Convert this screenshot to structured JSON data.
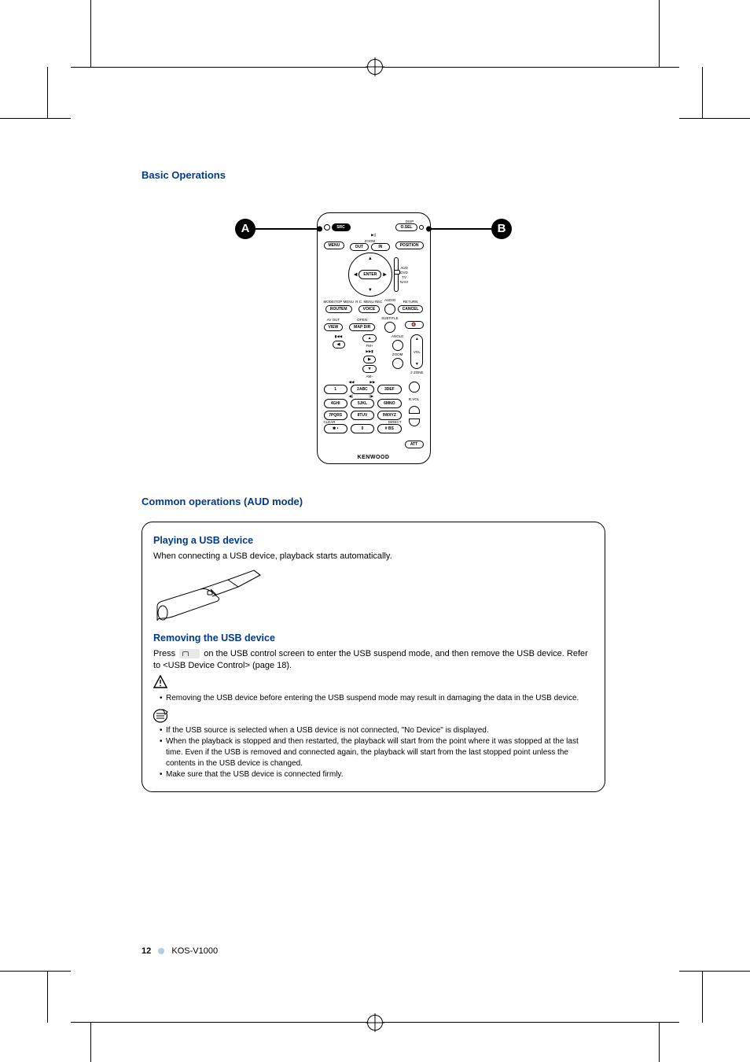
{
  "header": {
    "section_title": "Basic Operations"
  },
  "callouts": {
    "a": "A",
    "b": "B"
  },
  "remote": {
    "top_labels": {
      "disp": "DISP"
    },
    "src": "SRC",
    "osel": "O.SEL",
    "zoom_row": {
      "menu": "MENU",
      "zoom": "ZOOM",
      "out": "OUT",
      "in": "IN",
      "position": "POSITION"
    },
    "enter": "ENTER",
    "mode_labels": {
      "aud": "AUD",
      "dvd": "DVD",
      "tv": "TV",
      "navi": "NAVI"
    },
    "row_fn": {
      "routem_top": "MODE/TOP MENU",
      "routem": "ROUTEM",
      "voice_top": "R.C. MENU REC",
      "voice": "VOICE",
      "audio_top": "AUDIO",
      "cancel_top": "RETURN",
      "cancel": "CANCEL"
    },
    "row_view": {
      "avout": "AV OUT",
      "open": "OPEN",
      "subtitle": "SUBTITLE",
      "view": "VIEW",
      "mapdir": "MAP DIR"
    },
    "nav": {
      "fm": "FM+",
      "am": "AM–",
      "angle": "ANGLE",
      "zoom": "ZOOM",
      "prev": "▮◀◀",
      "next": "▶▶▮"
    },
    "vol": {
      "label": "VOL",
      "zone": "2 ZONE"
    },
    "keypad": {
      "row1": [
        "1",
        "2ABC",
        "3DEF"
      ],
      "row1_top": [
        "◀◀",
        "▶▶"
      ],
      "row2": [
        "4GHI",
        "5JKL",
        "6MNO"
      ],
      "row2_top": [
        "◀||",
        "||▶"
      ],
      "row3": [
        "7PQRS",
        "8TUV",
        "9WXYZ"
      ],
      "rvol": "R.VOL",
      "row4_left": "✱ •",
      "row4_0": "0",
      "row4_hash": "# BS",
      "att": "ATT",
      "clear": "CLEAR",
      "direct": "DIRECT"
    },
    "brand": "KENWOOD"
  },
  "subheader": "Common operations (AUD mode)",
  "box": {
    "h1": "Playing a USB device",
    "p1": "When connecting a USB device, playback starts automatically.",
    "h2": "Removing the USB device",
    "p2a": "Press ",
    "p2b": " on the USB control screen to enter the USB suspend mode, and then remove the USB device. Refer to <USB Device Control> (page 18).",
    "warn1": "Removing the USB device before entering the USB suspend mode may result in damaging the data in the USB device.",
    "note1": "If the USB source is selected when a USB device is not connected, \"No Device\" is displayed.",
    "note2": "When the playback is stopped and then restarted, the playback will start from the point where it was stopped at the last time. Even if the USB is removed and connected again, the playback will start from the last stopped point unless the contents in the USB device is changed.",
    "note3": "Make sure that the USB device is connected firmly."
  },
  "footer": {
    "page": "12",
    "model": "KOS-V1000"
  }
}
